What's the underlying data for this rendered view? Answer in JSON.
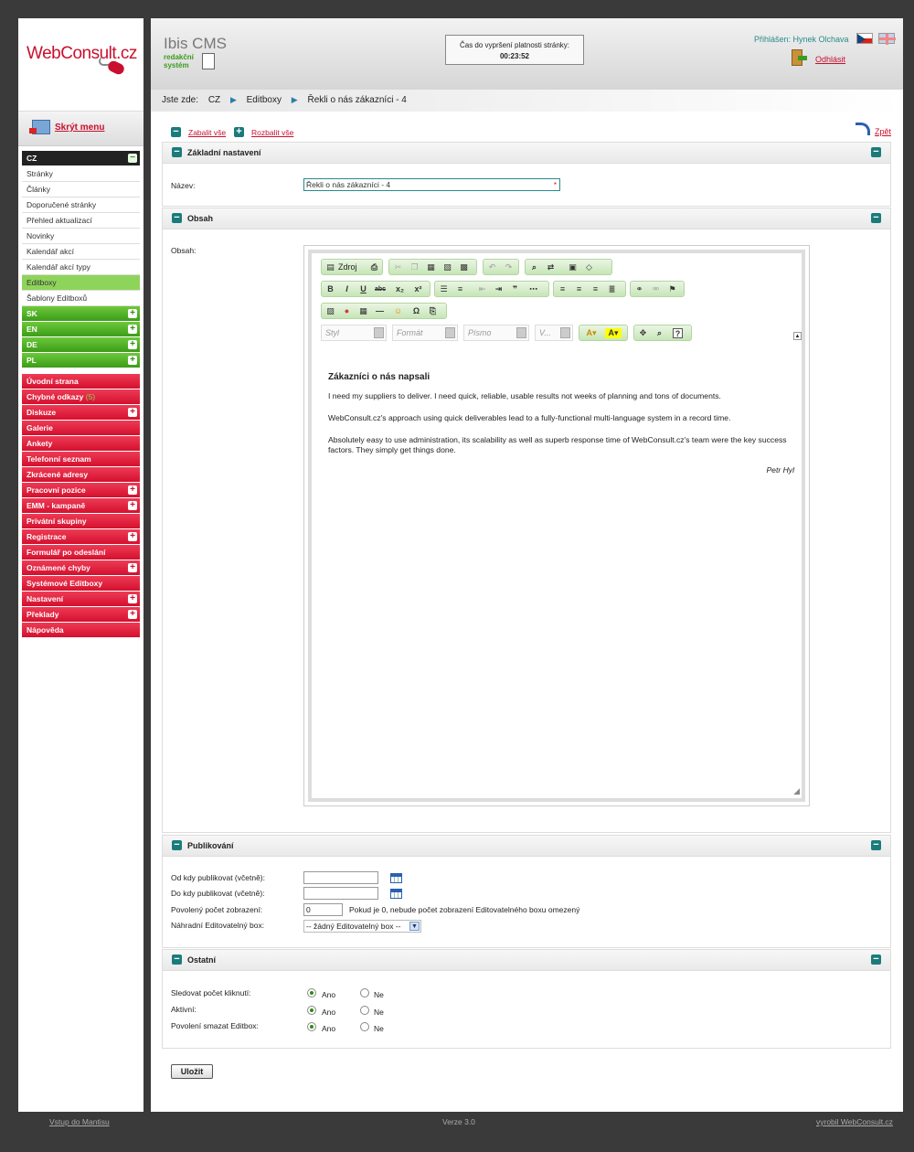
{
  "sidebar": {
    "logo_text": "WebConsult.cz",
    "hide_menu": "Skrýt menu",
    "cz_head": "CZ",
    "cz_items": [
      "Stránky",
      "Články",
      "Doporučené stránky",
      "Přehled aktualizací",
      "Novinky",
      "Kalendář akcí",
      "Kalendář akcí typy",
      "Editboxy",
      "Šablony Editboxů"
    ],
    "langs": [
      "SK",
      "EN",
      "DE",
      "PL"
    ],
    "red_items": [
      "Úvodní strana",
      "Chybné odkazy",
      "Diskuze",
      "Galerie",
      "Ankety",
      "Telefonní seznam",
      "Zkrácené adresy",
      "Pracovní pozice",
      "EMM - kampaně",
      "Privátní skupiny",
      "Registrace",
      "Formulář po odeslání",
      "Oznámené chyby",
      "Systémové Editboxy",
      "Nastavení",
      "Překlady",
      "Nápověda"
    ],
    "broken_links_count": "(5)"
  },
  "header": {
    "app_name": "Ibis CMS",
    "app_sub1": "redakční",
    "app_sub2": "systém",
    "timer_label": "Čas do vypršení platnosti stránky:",
    "timer_value": "00:23:52",
    "login_text": "Přihlášen: Hynek Olchava",
    "logout": "Odhlásit"
  },
  "breadcrumb": {
    "prefix": "Jste zde:",
    "items": [
      "CZ",
      "Editboxy",
      "Řekli o nás zákazníci - 4"
    ]
  },
  "actions": {
    "collapse_all": "Zabalit vše",
    "expand_all": "Rozbalit vše",
    "back": "Zpět"
  },
  "sections": {
    "basic": {
      "title": "Základní nastavení",
      "name_label": "Název:",
      "name_value": "Řekli o nás zákazníci - 4"
    },
    "content": {
      "title": "Obsah",
      "label": "Obsah:"
    },
    "publish": {
      "title": "Publikování",
      "from_label": "Od kdy publikovat (včetně):",
      "to_label": "Do kdy publikovat (včetně):",
      "count_label": "Povolený počet zobrazení:",
      "count_value": "0",
      "count_hint": "Pokud je 0, nebude počet zobrazení Editovatelného boxu omezený",
      "replace_label": "Náhradní Editovatelný box:",
      "replace_value": "-- žádný Editovatelný box --"
    },
    "other": {
      "title": "Ostatní",
      "rows": [
        {
          "label": "Sledovat počet kliknutí:",
          "yes": "Ano",
          "no": "Ne"
        },
        {
          "label": "Aktivní:",
          "yes": "Ano",
          "no": "Ne"
        },
        {
          "label": "Povolení smazat Editbox:",
          "yes": "Ano",
          "no": "Ne"
        }
      ]
    }
  },
  "editor": {
    "source_btn": "Zdroj",
    "style_combo": "Styl",
    "format_combo": "Formát",
    "font_combo": "Písmo",
    "size_combo": "V...",
    "heading": "Zákazníci o nás napsali",
    "p1": "I need my suppliers to deliver. I need quick, reliable, usable results not weeks of planning and tons of documents.",
    "p2": "WebConsult.cz's approach using quick deliverables lead to a fully-functional multi-language system in a record time.",
    "p3": "Absolutely easy to use administration, its scalability as well as superb response time of WebConsult.cz's team were the key success factors. They simply get things done.",
    "signature": "Petr Hyl"
  },
  "save_button": "Uložit",
  "footer": {
    "left": "Vstup do Mantisu",
    "center": "Verze 3.0",
    "right": "vyrobil WebConsult.cz"
  }
}
